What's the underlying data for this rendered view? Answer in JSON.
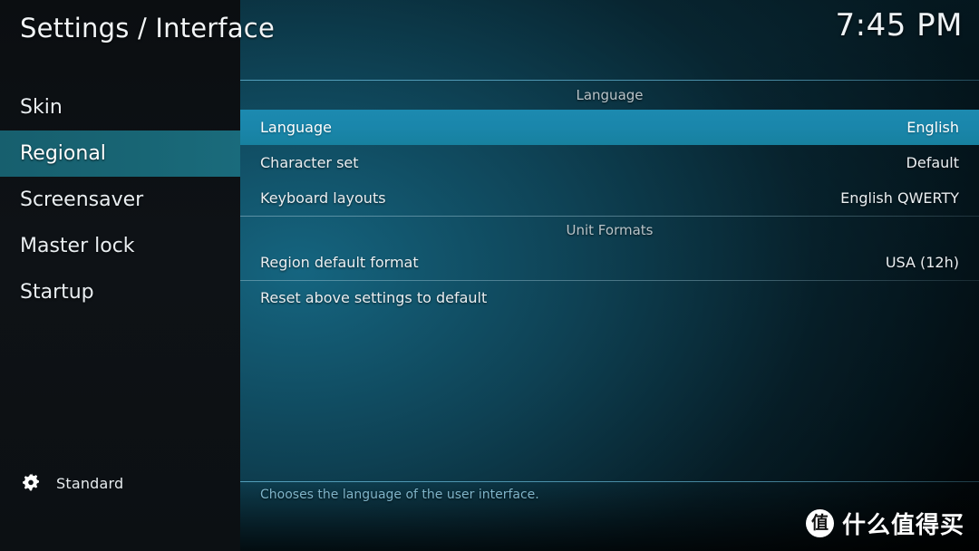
{
  "header": {
    "title": "Settings / Interface",
    "clock": "7:45 PM"
  },
  "sidebar": {
    "items": [
      {
        "label": "Skin",
        "selected": false
      },
      {
        "label": "Regional",
        "selected": true
      },
      {
        "label": "Screensaver",
        "selected": false
      },
      {
        "label": "Master lock",
        "selected": false
      },
      {
        "label": "Startup",
        "selected": false
      }
    ],
    "level": {
      "icon": "gear-icon",
      "label": "Standard"
    }
  },
  "content": {
    "groups": [
      {
        "header": "Language",
        "rule_above": false,
        "rows": [
          {
            "label": "Language",
            "value": "English",
            "focused": true,
            "rule_above": false
          },
          {
            "label": "Character set",
            "value": "Default",
            "focused": false,
            "rule_above": false
          },
          {
            "label": "Keyboard layouts",
            "value": "English QWERTY",
            "focused": false,
            "rule_above": false
          }
        ]
      },
      {
        "header": "Unit Formats",
        "rule_above": true,
        "rows": [
          {
            "label": "Region default format",
            "value": "USA (12h)",
            "focused": false,
            "rule_above": false
          },
          {
            "label": "Reset above settings to default",
            "value": "",
            "focused": false,
            "rule_above": true
          }
        ]
      }
    ]
  },
  "help": {
    "text": "Chooses the language of the user interface."
  },
  "watermark": {
    "badge": "值",
    "text": "什么值得买"
  },
  "colors": {
    "focus_row": "#1a86ab",
    "sidebar_selected": "#186574",
    "help_text": "#7fb4c9",
    "background_teal": "#136985",
    "sidebar_bg": "#0e1216"
  }
}
